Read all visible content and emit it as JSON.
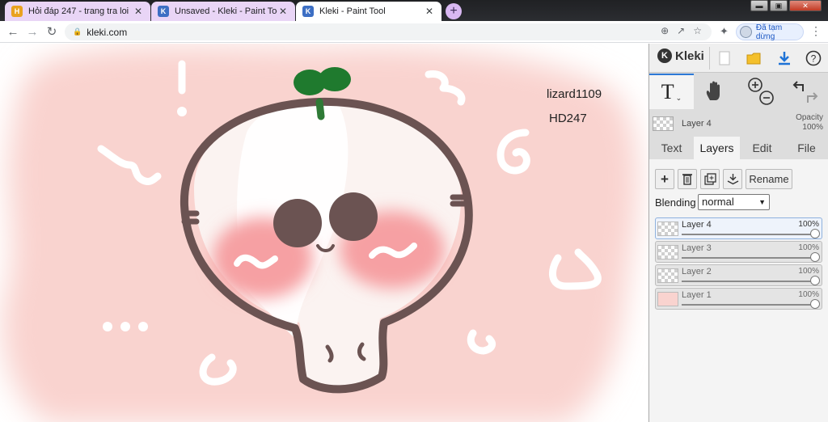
{
  "browser": {
    "tabs": [
      {
        "title": "Hỏi đáp 247 - trang tra loi",
        "close": "✕"
      },
      {
        "title": "Unsaved - Kleki - Paint Tool",
        "close": "✕"
      },
      {
        "title": "Kleki - Paint Tool",
        "close": "✕"
      }
    ],
    "new_tab": "+",
    "url": "kleki.com",
    "profile_status": "Đã tạm dừng",
    "window_buttons": {
      "minimize": "▬",
      "maximize": "▣",
      "close": "✕"
    }
  },
  "canvas": {
    "stamp_lines": [
      "lizard1109",
      "HD247"
    ]
  },
  "app": {
    "name": "Kleki",
    "header_icons": [
      "new-image-icon",
      "folder-icon",
      "download-icon",
      "help-icon"
    ],
    "tools": [
      "text-tool-icon",
      "hand-tool-icon",
      "zoom-in-icon",
      "zoom-out-icon",
      "undo-icon",
      "redo-icon"
    ],
    "current_layer": {
      "name": "Layer 4",
      "opacity_label": "Opacity",
      "opacity_value": "100%"
    },
    "panel_tabs": [
      {
        "label": "Text",
        "active": false
      },
      {
        "label": "Layers",
        "active": true
      },
      {
        "label": "Edit",
        "active": false
      },
      {
        "label": "File",
        "active": false
      }
    ],
    "layer_buttons": {
      "add": "+",
      "delete": "delete-icon",
      "duplicate": "duplicate-icon",
      "merge": "merge-icon",
      "rename": "Rename"
    },
    "blending": {
      "label": "Blending",
      "value": "normal"
    },
    "layers": [
      {
        "name": "Layer 4",
        "opacity": "100%",
        "opacity_fraction": 1.0,
        "selected": true
      },
      {
        "name": "Layer 3",
        "opacity": "100%",
        "opacity_fraction": 1.0,
        "selected": false
      },
      {
        "name": "Layer 2",
        "opacity": "100%",
        "opacity_fraction": 1.0,
        "selected": false
      },
      {
        "name": "Layer 1",
        "opacity": "100%",
        "opacity_fraction": 1.0,
        "selected": false
      }
    ],
    "colors": {
      "accent": "#2d79d6",
      "folder": "#f4c02c",
      "download": "#1f73d6"
    }
  }
}
